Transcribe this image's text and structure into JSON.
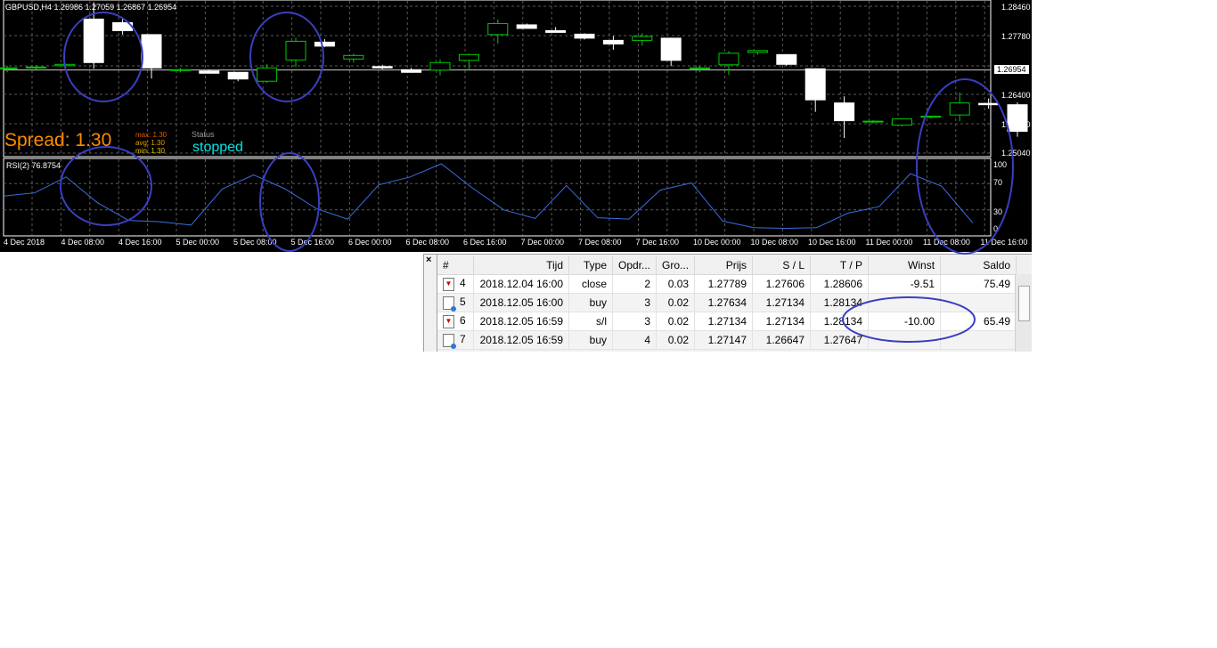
{
  "symbol_header": "GBPUSD,H4  1.26986 1.27059 1.26867 1.26954",
  "price_axis": [
    "1.28460",
    "1.27780",
    "1.26954",
    "1.26400",
    "1.25720",
    "1.25040"
  ],
  "current_price": "1.26954",
  "spread": {
    "label": "Spread: 1.30",
    "max": "max: 1.30",
    "avg": "avg: 1.30",
    "min": "min: 1.30"
  },
  "status": {
    "title": "Status",
    "value": "stopped"
  },
  "rsi": {
    "label": "RSI(2) 76.8754",
    "levels": [
      "100",
      "70",
      "30",
      "0"
    ]
  },
  "time_axis": [
    "4 Dec 2018",
    "4 Dec 08:00",
    "4 Dec 16:00",
    "5 Dec 00:00",
    "5 Dec 08:00",
    "5 Dec 16:00",
    "6 Dec 00:00",
    "6 Dec 08:00",
    "6 Dec 16:00",
    "7 Dec 00:00",
    "7 Dec 08:00",
    "7 Dec 16:00",
    "10 Dec 00:00",
    "10 Dec 08:00",
    "10 Dec 16:00",
    "11 Dec 00:00",
    "11 Dec 08:00",
    "11 Dec 16:00"
  ],
  "colors": {
    "bull": "#00cc00",
    "bear": "#ffffff",
    "rsi_line": "#3b6fe0",
    "annotation": "#3a3fc0",
    "spread": "#ff8c00",
    "status": "#00e5e5"
  },
  "candles": [
    {
      "o": 1.2698,
      "h": 1.2705,
      "l": 1.269,
      "c": 1.27
    },
    {
      "o": 1.27,
      "h": 1.2706,
      "l": 1.2696,
      "c": 1.2702
    },
    {
      "o": 1.2705,
      "h": 1.2712,
      "l": 1.27,
      "c": 1.2708
    },
    {
      "o": 1.281,
      "h": 1.2848,
      "l": 1.2698,
      "c": 1.2712
    },
    {
      "o": 1.2802,
      "h": 1.2812,
      "l": 1.2775,
      "c": 1.2784
    },
    {
      "o": 1.2775,
      "h": 1.2776,
      "l": 1.2676,
      "c": 1.27
    },
    {
      "o": 1.2696,
      "h": 1.27,
      "l": 1.269,
      "c": 1.2696
    },
    {
      "o": 1.2693,
      "h": 1.2696,
      "l": 1.2688,
      "c": 1.2688
    },
    {
      "o": 1.269,
      "h": 1.269,
      "l": 1.267,
      "c": 1.2675
    },
    {
      "o": 1.267,
      "h": 1.2708,
      "l": 1.2666,
      "c": 1.27
    },
    {
      "o": 1.2718,
      "h": 1.2768,
      "l": 1.2702,
      "c": 1.276
    },
    {
      "o": 1.2758,
      "h": 1.2765,
      "l": 1.2747,
      "c": 1.2749
    },
    {
      "o": 1.272,
      "h": 1.2732,
      "l": 1.2712,
      "c": 1.2728
    },
    {
      "o": 1.2703,
      "h": 1.2707,
      "l": 1.2697,
      "c": 1.27
    },
    {
      "o": 1.2696,
      "h": 1.27,
      "l": 1.2689,
      "c": 1.269
    },
    {
      "o": 1.2695,
      "h": 1.2719,
      "l": 1.2683,
      "c": 1.2712
    },
    {
      "o": 1.2717,
      "h": 1.2732,
      "l": 1.2697,
      "c": 1.273
    },
    {
      "o": 1.2775,
      "h": 1.2809,
      "l": 1.2755,
      "c": 1.28
    },
    {
      "o": 1.2797,
      "h": 1.28,
      "l": 1.2789,
      "c": 1.2789
    },
    {
      "o": 1.2784,
      "h": 1.2792,
      "l": 1.278,
      "c": 1.278
    },
    {
      "o": 1.2776,
      "h": 1.2778,
      "l": 1.2764,
      "c": 1.2767
    },
    {
      "o": 1.2762,
      "h": 1.2772,
      "l": 1.2741,
      "c": 1.2754
    },
    {
      "o": 1.2762,
      "h": 1.2778,
      "l": 1.275,
      "c": 1.2771
    },
    {
      "o": 1.2767,
      "h": 1.2768,
      "l": 1.2704,
      "c": 1.2717
    },
    {
      "o": 1.2699,
      "h": 1.2704,
      "l": 1.269,
      "c": 1.27
    },
    {
      "o": 1.2707,
      "h": 1.2738,
      "l": 1.2684,
      "c": 1.2733
    },
    {
      "o": 1.2735,
      "h": 1.274,
      "l": 1.273,
      "c": 1.2739
    },
    {
      "o": 1.273,
      "h": 1.2731,
      "l": 1.2705,
      "c": 1.2708
    },
    {
      "o": 1.2698,
      "h": 1.2699,
      "l": 1.2601,
      "c": 1.2628
    },
    {
      "o": 1.2621,
      "h": 1.2636,
      "l": 1.2542,
      "c": 1.2581
    },
    {
      "o": 1.2578,
      "h": 1.2582,
      "l": 1.2575,
      "c": 1.258
    },
    {
      "o": 1.2571,
      "h": 1.2586,
      "l": 1.2568,
      "c": 1.2585
    },
    {
      "o": 1.2589,
      "h": 1.2592,
      "l": 1.2586,
      "c": 1.2591
    },
    {
      "o": 1.2594,
      "h": 1.2645,
      "l": 1.258,
      "c": 1.2621
    },
    {
      "o": 1.262,
      "h": 1.2631,
      "l": 1.2608,
      "c": 1.2617
    },
    {
      "o": 1.2617,
      "h": 1.2622,
      "l": 1.2545,
      "c": 1.2557
    }
  ],
  "rsi_values": [
    51,
    56,
    80,
    41,
    14,
    12,
    7,
    62,
    83,
    62,
    32,
    16,
    68,
    80,
    100,
    63,
    30,
    17,
    67,
    18,
    16,
    60,
    71,
    13,
    3,
    2,
    3,
    25,
    35,
    85,
    66,
    10
  ],
  "trade_table": {
    "headers": [
      "#",
      "Tijd",
      "Type",
      "Opdr...",
      "Gro...",
      "Prijs",
      "S / L",
      "T / P",
      "Winst",
      "Saldo"
    ],
    "rows": [
      {
        "icon": "sell",
        "idx": "4",
        "time": "2018.12.04 16:00",
        "type": "close",
        "order": "2",
        "size": "0.03",
        "price": "1.27789",
        "sl": "1.27606",
        "tp": "1.28606",
        "profit": "-9.51",
        "balance": "75.49"
      },
      {
        "icon": "buy",
        "idx": "5",
        "time": "2018.12.05 16:00",
        "type": "buy",
        "order": "3",
        "size": "0.02",
        "price": "1.27634",
        "sl": "1.27134",
        "tp": "1.28134",
        "profit": "",
        "balance": ""
      },
      {
        "icon": "sell",
        "idx": "6",
        "time": "2018.12.05 16:59",
        "type": "s/l",
        "order": "3",
        "size": "0.02",
        "price": "1.27134",
        "sl": "1.27134",
        "tp": "1.28134",
        "profit": "-10.00",
        "balance": "65.49"
      },
      {
        "icon": "buy",
        "idx": "7",
        "time": "2018.12.05 16:59",
        "type": "buy",
        "order": "4",
        "size": "0.02",
        "price": "1.27147",
        "sl": "1.26647",
        "tp": "1.27647",
        "profit": "",
        "balance": ""
      }
    ]
  }
}
